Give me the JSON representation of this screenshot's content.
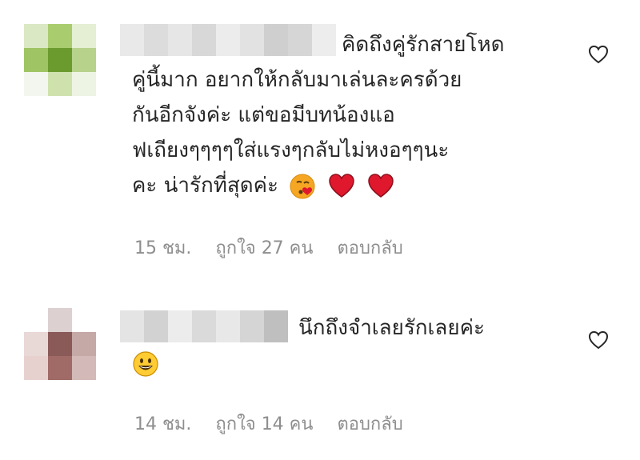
{
  "comments": [
    {
      "lines": [
        "คิดถึงคู่รักสายโหด",
        "คู่นี้มาก อยากให้กลับมาเล่นละครด้วย",
        "กันอีกจังค่ะ แต่ขอมีบทน้องแอ",
        "ฟเถียงๆๆๆๆใส่แรงๆกลับไม่หงอๆๆนะ",
        "คะ น่ารักที่สุดค่ะ"
      ],
      "emojis": [
        "kiss-heart-emoji",
        "red-heart-emoji",
        "red-heart-emoji"
      ],
      "time": "15 ชม.",
      "likes": "ถูกใจ 27 คน",
      "reply": "ตอบกลับ",
      "avatar_colors": [
        "#dbe8c4",
        "#a9cc6f",
        "#e4efd3",
        "#9fc463",
        "#6b9b2e",
        "#b7d28a",
        "#f3f6ee",
        "#cfe2ae",
        "#eef4e4"
      ]
    },
    {
      "lines": [
        "นึกถึงจำเลยรักเลยค่ะ"
      ],
      "emojis": [
        "grinning-emoji"
      ],
      "time": "14 ชม.",
      "likes": "ถูกใจ 14 คน",
      "reply": "ตอบกลับ",
      "avatar_colors": [
        "#ffffff",
        "#dcd0d0",
        "#ffffff",
        "#e8d8d6",
        "#8a5a58",
        "#c5a9a7",
        "#e7d1cf",
        "#a06a66",
        "#d3b9b7"
      ]
    }
  ],
  "colors": {
    "text": "#262626",
    "meta": "#8e8e8e",
    "heart_red": "#e0182d"
  }
}
